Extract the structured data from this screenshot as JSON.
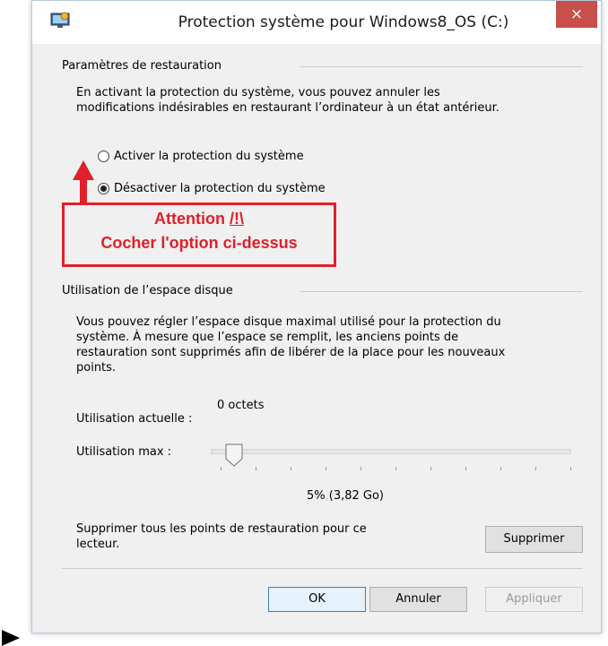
{
  "window": {
    "title": "Protection système pour Windows8_OS (C:)",
    "close_label": "×"
  },
  "restore": {
    "group_title": "Paramètres de restauration",
    "description_lines": [
      "En activant la protection du système, vous pouvez annuler les",
      "modifications indésirables en restaurant l’ordinateur à un état antérieur."
    ],
    "options": [
      {
        "label": "Activer la protection du système",
        "checked": false
      },
      {
        "label": "Désactiver la protection du système",
        "checked": true
      }
    ]
  },
  "annotation": {
    "line1_prefix": "Attention ",
    "line1_mark": "/!\\",
    "line2": "Cocher l'option ci-dessus",
    "color": "#e0202a"
  },
  "disk": {
    "group_title": "Utilisation de l’espace disque",
    "description_lines": [
      "Vous pouvez régler l’espace disque maximal utilisé pour la protection du",
      "système. À mesure que l’espace se remplit, les anciens points de",
      "restauration sont supprimés afin de libérer de la place pour les nouveaux",
      "points."
    ],
    "current_label": "Utilisation actuelle :",
    "current_value": "0 octets",
    "max_label": "Utilisation max :",
    "max_value": "5% (3,82 Go)",
    "max_percent": 5,
    "delete_text_lines": [
      "Supprimer tous les points de restauration pour ce",
      "lecteur."
    ],
    "delete_button": "Supprimer"
  },
  "footer": {
    "ok": "OK",
    "cancel": "Annuler",
    "apply": "Appliquer"
  },
  "colors": {
    "accent_close": "#c7504a",
    "default_button_border": "#3c7fb1"
  }
}
